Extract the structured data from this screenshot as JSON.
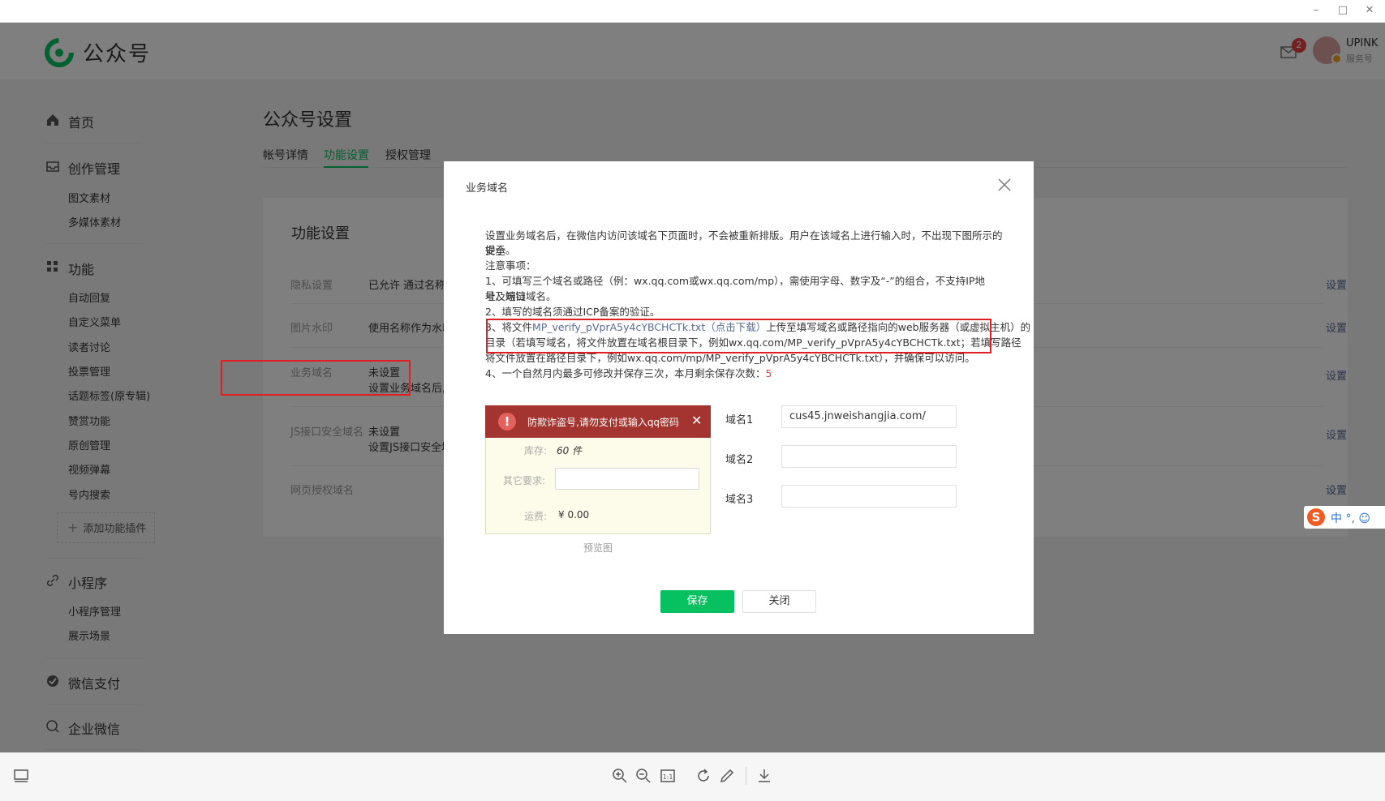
{
  "window": {
    "minimize": "–",
    "maximize": "□",
    "close": "✕"
  },
  "header": {
    "brand": "公众号",
    "message_count": "2",
    "account_name": "UPINK",
    "account_type": "服务号"
  },
  "sidebar": {
    "home": "首页",
    "create": {
      "label": "创作管理",
      "items": [
        "图文素材",
        "多媒体素材"
      ]
    },
    "features": {
      "label": "功能",
      "items": [
        "自动回复",
        "自定义菜单",
        "读者讨论",
        "投票管理",
        "话题标签(原专辑)",
        "赞赏功能",
        "原创管理",
        "视频弹幕",
        "号内搜索"
      ]
    },
    "add_plugin": "添加功能插件",
    "mini": {
      "label": "小程序",
      "items": [
        "小程序管理",
        "展示场景"
      ]
    },
    "pay": "微信支付",
    "work": "企业微信"
  },
  "main": {
    "title": "公众号设置",
    "tabs": [
      "帐号详情",
      "功能设置",
      "授权管理"
    ],
    "active_tab": "功能设置",
    "card_title": "功能设置",
    "rows": [
      {
        "label": "隐私设置",
        "value": "已允许 通过名称搜",
        "link": "设置"
      },
      {
        "label": "图片水印",
        "value": "使用名称作为水印",
        "link": "设置"
      },
      {
        "label": "业务域名",
        "value": "未设置",
        "value2": "设置业务域名后,",
        "link": "设置"
      },
      {
        "label": "JS接口安全域名",
        "value": "未设置",
        "value2": "设置JS接口安全域",
        "link": "设置"
      },
      {
        "label": "网页授权域名",
        "value": "",
        "link": "设置"
      }
    ]
  },
  "dialog": {
    "title": "业务域名",
    "intro_1": "设置业务域名后，在微信内访问该域名下页面时，不会被重新排版。用户在该域名上进行输入时，不出现下图所示的安全",
    "intro_2": "提示。",
    "notice": "注意事项：",
    "item1_a": "1、可填写三个域名或路径（例：wx.qq.com或wx.qq.com/mp），需使用字母、数字及“-”的组合，不支持IP地址、端口",
    "item1_b": "号及短链域名。",
    "item2": "2、填写的域名须通过ICP备案的验证。",
    "item3_prefix": "3、将文件",
    "item3_file": "MP_verify_pVprA5y4cYBCHCTk.txt",
    "item3_download": "（点击下载）",
    "item3_suffix": "上传至填写域名或路径指向的web服务器（或虚拟主机）的",
    "item3_b": "目录（若填写域名，将文件放置在域名根目录下，例如wx.qq.com/MP_verify_pVprA5y4cYBCHCTk.txt；若填写路径",
    "item3_c": "将文件放置在路径目录下，例如wx.qq.com/mp/MP_verify_pVprA5y4cYBCHCTk.txt），并确保可以访问。",
    "item4_prefix": "4、一个自然月内最多可修改并保存三次，本月剩余保存次数：",
    "item4_count": "5",
    "preview": {
      "warning": "防欺诈盗号,请勿支付或输入qq密码",
      "stock_label": "库存:",
      "stock_value": "60 件",
      "other_label": "其它要求:",
      "shipping_label": "运费:",
      "shipping_value": "¥ 0.00",
      "caption": "预览图"
    },
    "domains": [
      {
        "label": "域名1",
        "value": "cus45.jnweishangjia.com/"
      },
      {
        "label": "域名2",
        "value": ""
      },
      {
        "label": "域名3",
        "value": ""
      }
    ],
    "save": "保存",
    "close": "关闭"
  },
  "ime": {
    "logo": "S",
    "text": "中 °, ☺"
  },
  "colors": {
    "accent": "#07c160",
    "link": "#576b95",
    "warning": "#a3342f",
    "highlight_box": "#e02020"
  }
}
